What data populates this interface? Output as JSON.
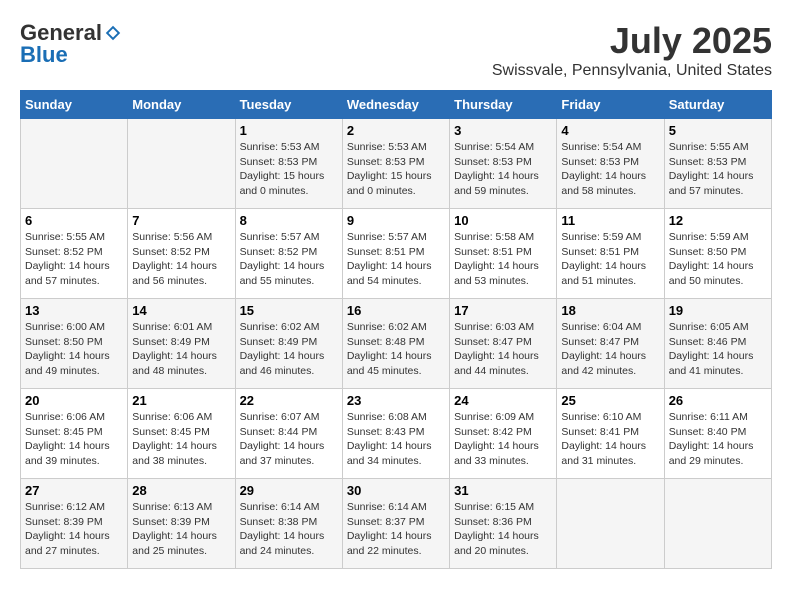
{
  "header": {
    "logo_general": "General",
    "logo_blue": "Blue",
    "month": "July 2025",
    "location": "Swissvale, Pennsylvania, United States"
  },
  "weekdays": [
    "Sunday",
    "Monday",
    "Tuesday",
    "Wednesday",
    "Thursday",
    "Friday",
    "Saturday"
  ],
  "weeks": [
    [
      null,
      null,
      {
        "day": "1",
        "sunrise": "Sunrise: 5:53 AM",
        "sunset": "Sunset: 8:53 PM",
        "daylight": "Daylight: 15 hours and 0 minutes."
      },
      {
        "day": "2",
        "sunrise": "Sunrise: 5:53 AM",
        "sunset": "Sunset: 8:53 PM",
        "daylight": "Daylight: 15 hours and 0 minutes."
      },
      {
        "day": "3",
        "sunrise": "Sunrise: 5:54 AM",
        "sunset": "Sunset: 8:53 PM",
        "daylight": "Daylight: 14 hours and 59 minutes."
      },
      {
        "day": "4",
        "sunrise": "Sunrise: 5:54 AM",
        "sunset": "Sunset: 8:53 PM",
        "daylight": "Daylight: 14 hours and 58 minutes."
      },
      {
        "day": "5",
        "sunrise": "Sunrise: 5:55 AM",
        "sunset": "Sunset: 8:53 PM",
        "daylight": "Daylight: 14 hours and 57 minutes."
      }
    ],
    [
      {
        "day": "6",
        "sunrise": "Sunrise: 5:55 AM",
        "sunset": "Sunset: 8:52 PM",
        "daylight": "Daylight: 14 hours and 57 minutes."
      },
      {
        "day": "7",
        "sunrise": "Sunrise: 5:56 AM",
        "sunset": "Sunset: 8:52 PM",
        "daylight": "Daylight: 14 hours and 56 minutes."
      },
      {
        "day": "8",
        "sunrise": "Sunrise: 5:57 AM",
        "sunset": "Sunset: 8:52 PM",
        "daylight": "Daylight: 14 hours and 55 minutes."
      },
      {
        "day": "9",
        "sunrise": "Sunrise: 5:57 AM",
        "sunset": "Sunset: 8:51 PM",
        "daylight": "Daylight: 14 hours and 54 minutes."
      },
      {
        "day": "10",
        "sunrise": "Sunrise: 5:58 AM",
        "sunset": "Sunset: 8:51 PM",
        "daylight": "Daylight: 14 hours and 53 minutes."
      },
      {
        "day": "11",
        "sunrise": "Sunrise: 5:59 AM",
        "sunset": "Sunset: 8:51 PM",
        "daylight": "Daylight: 14 hours and 51 minutes."
      },
      {
        "day": "12",
        "sunrise": "Sunrise: 5:59 AM",
        "sunset": "Sunset: 8:50 PM",
        "daylight": "Daylight: 14 hours and 50 minutes."
      }
    ],
    [
      {
        "day": "13",
        "sunrise": "Sunrise: 6:00 AM",
        "sunset": "Sunset: 8:50 PM",
        "daylight": "Daylight: 14 hours and 49 minutes."
      },
      {
        "day": "14",
        "sunrise": "Sunrise: 6:01 AM",
        "sunset": "Sunset: 8:49 PM",
        "daylight": "Daylight: 14 hours and 48 minutes."
      },
      {
        "day": "15",
        "sunrise": "Sunrise: 6:02 AM",
        "sunset": "Sunset: 8:49 PM",
        "daylight": "Daylight: 14 hours and 46 minutes."
      },
      {
        "day": "16",
        "sunrise": "Sunrise: 6:02 AM",
        "sunset": "Sunset: 8:48 PM",
        "daylight": "Daylight: 14 hours and 45 minutes."
      },
      {
        "day": "17",
        "sunrise": "Sunrise: 6:03 AM",
        "sunset": "Sunset: 8:47 PM",
        "daylight": "Daylight: 14 hours and 44 minutes."
      },
      {
        "day": "18",
        "sunrise": "Sunrise: 6:04 AM",
        "sunset": "Sunset: 8:47 PM",
        "daylight": "Daylight: 14 hours and 42 minutes."
      },
      {
        "day": "19",
        "sunrise": "Sunrise: 6:05 AM",
        "sunset": "Sunset: 8:46 PM",
        "daylight": "Daylight: 14 hours and 41 minutes."
      }
    ],
    [
      {
        "day": "20",
        "sunrise": "Sunrise: 6:06 AM",
        "sunset": "Sunset: 8:45 PM",
        "daylight": "Daylight: 14 hours and 39 minutes."
      },
      {
        "day": "21",
        "sunrise": "Sunrise: 6:06 AM",
        "sunset": "Sunset: 8:45 PM",
        "daylight": "Daylight: 14 hours and 38 minutes."
      },
      {
        "day": "22",
        "sunrise": "Sunrise: 6:07 AM",
        "sunset": "Sunset: 8:44 PM",
        "daylight": "Daylight: 14 hours and 37 minutes."
      },
      {
        "day": "23",
        "sunrise": "Sunrise: 6:08 AM",
        "sunset": "Sunset: 8:43 PM",
        "daylight": "Daylight: 14 hours and 34 minutes."
      },
      {
        "day": "24",
        "sunrise": "Sunrise: 6:09 AM",
        "sunset": "Sunset: 8:42 PM",
        "daylight": "Daylight: 14 hours and 33 minutes."
      },
      {
        "day": "25",
        "sunrise": "Sunrise: 6:10 AM",
        "sunset": "Sunset: 8:41 PM",
        "daylight": "Daylight: 14 hours and 31 minutes."
      },
      {
        "day": "26",
        "sunrise": "Sunrise: 6:11 AM",
        "sunset": "Sunset: 8:40 PM",
        "daylight": "Daylight: 14 hours and 29 minutes."
      }
    ],
    [
      {
        "day": "27",
        "sunrise": "Sunrise: 6:12 AM",
        "sunset": "Sunset: 8:39 PM",
        "daylight": "Daylight: 14 hours and 27 minutes."
      },
      {
        "day": "28",
        "sunrise": "Sunrise: 6:13 AM",
        "sunset": "Sunset: 8:39 PM",
        "daylight": "Daylight: 14 hours and 25 minutes."
      },
      {
        "day": "29",
        "sunrise": "Sunrise: 6:14 AM",
        "sunset": "Sunset: 8:38 PM",
        "daylight": "Daylight: 14 hours and 24 minutes."
      },
      {
        "day": "30",
        "sunrise": "Sunrise: 6:14 AM",
        "sunset": "Sunset: 8:37 PM",
        "daylight": "Daylight: 14 hours and 22 minutes."
      },
      {
        "day": "31",
        "sunrise": "Sunrise: 6:15 AM",
        "sunset": "Sunset: 8:36 PM",
        "daylight": "Daylight: 14 hours and 20 minutes."
      },
      null,
      null
    ]
  ]
}
